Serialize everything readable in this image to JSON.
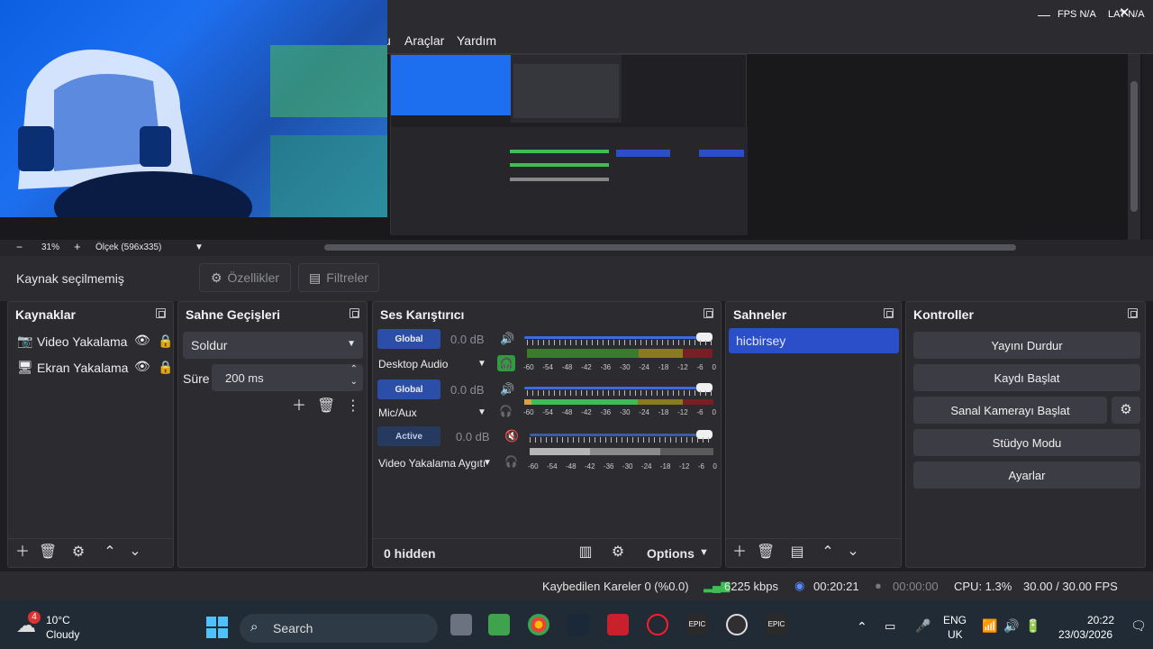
{
  "menu": {
    "partial_item": "u",
    "items": [
      "Araçlar",
      "Yardım"
    ],
    "fps_label": "FPS N/A",
    "lat_label": "LAT N/A"
  },
  "preview_status": {
    "minus": "−",
    "zoom": "31%",
    "plus": "+",
    "scale": "Ölçek (596x335)"
  },
  "source_bar": {
    "no_source": "Kaynak seçilmemiş",
    "properties": "Özellikler",
    "filters": "Filtreler"
  },
  "docks": {
    "sources": {
      "title": "Kaynaklar",
      "items": [
        {
          "label": "Video Yakalama",
          "icon": "camera-icon"
        },
        {
          "label": "Ekran Yakalama",
          "icon": "monitor-icon"
        }
      ]
    },
    "transitions": {
      "title": "Sahne Geçişleri",
      "selected": "Soldur",
      "duration_label": "Süre",
      "duration_value": "200 ms"
    },
    "mixer": {
      "title": "Ses Karıştırıcı",
      "channels": [
        {
          "badge": "Global",
          "db": "0.0 dB",
          "name": "Desktop Audio",
          "muted": false
        },
        {
          "badge": "Global",
          "db": "0.0 dB",
          "name": "Mic/Aux",
          "muted": false
        },
        {
          "badge": "Active",
          "db": "0.0 dB",
          "name": "Video Yakalama Aygıtı",
          "muted": true
        }
      ],
      "scale": [
        "-60",
        "-54",
        "-48",
        "-42",
        "-36",
        "-30",
        "-24",
        "-18",
        "-12",
        "-6",
        "0"
      ],
      "hidden": "0 hidden",
      "options": "Options"
    },
    "scenes": {
      "title": "Sahneler",
      "items": [
        "hicbirsey"
      ]
    },
    "controls": {
      "title": "Kontroller",
      "buttons": [
        "Yayını Durdur",
        "Kaydı Başlat",
        "Sanal Kamerayı Başlat",
        "Stüdyo Modu",
        "Ayarlar"
      ]
    }
  },
  "obs_status": {
    "dropped": "Kaybedilen Kareler 0 (%0.0)",
    "bitrate": "6225 kbps",
    "stream_time": "00:20:21",
    "rec_time": "00:00:00",
    "cpu": "CPU: 1.3%",
    "fps": "30.00 / 30.00 FPS"
  },
  "taskbar": {
    "weather_temp": "10°C",
    "weather_desc": "Cloudy",
    "weather_badge": "4",
    "search": "Search",
    "lang1": "ENG",
    "lang2": "UK",
    "time": "20:22",
    "date": "23/03/2026"
  },
  "colors": {
    "accent": "#2a4fc8",
    "panel": "#2b2b30",
    "meter_green": "#3dbd52",
    "meter_yellow": "#c6a020",
    "meter_red": "#b42a2a"
  }
}
